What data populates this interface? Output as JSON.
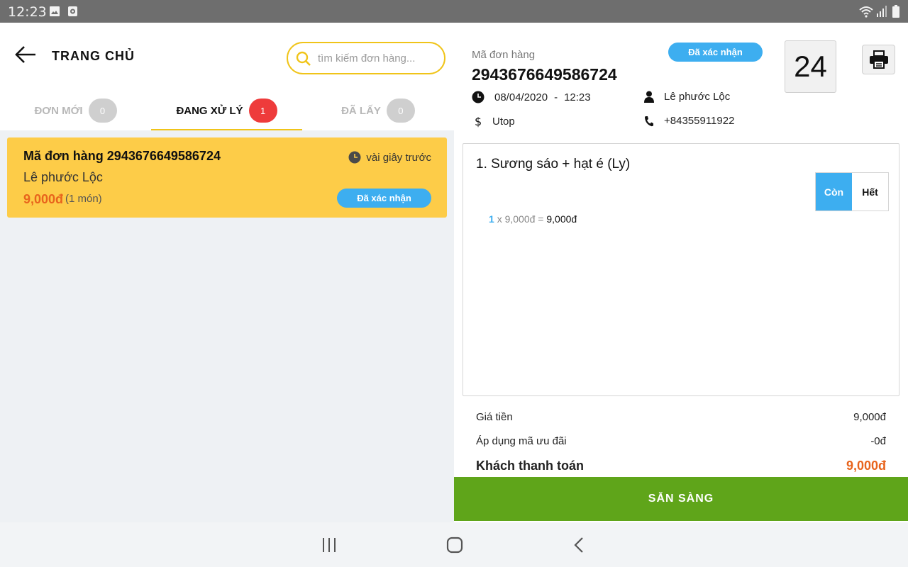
{
  "status_bar": {
    "time": "12:23"
  },
  "left_panel": {
    "title": "TRANG CHỦ",
    "search": {
      "placeholder": "tìm kiếm đơn hàng..."
    },
    "tabs": [
      {
        "label": "ĐƠN MỚI",
        "count": "0",
        "active": false
      },
      {
        "label": "ĐANG XỬ LÝ",
        "count": "1",
        "active": true
      },
      {
        "label": "ĐÃ LẤY",
        "count": "0",
        "active": false
      }
    ],
    "orders": [
      {
        "title": "Mã đơn hàng 2943676649586724",
        "customer": "Lê phước Lộc",
        "price": "9,000đ",
        "quantity": "(1 món)",
        "time": "vài giây trước",
        "status": "Đã xác nhận"
      }
    ]
  },
  "detail": {
    "code_label": "Mã đơn hàng",
    "code": "2943676649586724",
    "status": "Đã xác nhận",
    "table_number": "24",
    "date": "08/04/2020",
    "separator": "-",
    "time": "12:23",
    "customer": "Lê phước Lộc",
    "payment": "Utop",
    "phone": "+84355911922",
    "items": [
      {
        "name": "1. Sương sáo + hạt é (Ly)",
        "available_label": "Còn",
        "sold_out_label": "Hết",
        "qty": "1",
        "unit_price": "x 9,000đ =",
        "line_total": "9,000đ"
      }
    ],
    "summary": {
      "price_label": "Giá tiền",
      "price_value": "9,000đ",
      "discount_label": "Áp dụng mã ưu đãi",
      "discount_value": "-0đ",
      "total_label": "Khách thanh toán",
      "total_value": "9,000đ"
    },
    "ready_label": "SẴN SÀNG"
  },
  "colors": {
    "accent_yellow": "#f0c419",
    "card_yellow": "#fdcc48",
    "blue": "#3daef0",
    "green": "#5fa51a",
    "orange": "#e8641c",
    "red_badge": "#ee3b3b"
  },
  "icons": {
    "back": "arrow-left-icon",
    "search": "search-icon",
    "clock": "clock-icon",
    "print": "printer-icon",
    "user": "user-icon",
    "dollar": "dollar-icon",
    "phone": "phone-icon"
  }
}
